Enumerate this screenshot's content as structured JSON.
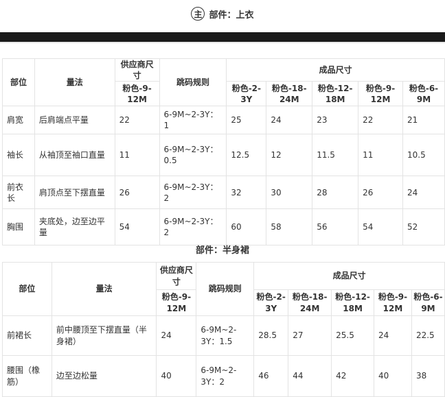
{
  "header": {
    "badge": "主",
    "title": "部件：上衣"
  },
  "tables": [
    {
      "headers": {
        "part": "部位",
        "method": "量法",
        "supplier_size": "供应商尺寸",
        "supplier_col": "粉色-9-12M",
        "rule": "跳码规则",
        "finished": "成品尺寸",
        "sizes": [
          "粉色-2-3Y",
          "粉色-18-24M",
          "粉色-12-18M",
          "粉色-9-12M",
          "粉色-6-9M"
        ]
      },
      "rows": [
        {
          "part": "肩宽",
          "method": "后肩端点平量",
          "supplier": "22",
          "rule": "6-9M~2-3Y：1",
          "values": [
            "25",
            "24",
            "23",
            "22",
            "21"
          ]
        },
        {
          "part": "袖长",
          "method": "从袖顶至袖口直量",
          "supplier": "11",
          "rule": "6-9M~2-3Y：0.5",
          "values": [
            "12.5",
            "12",
            "11.5",
            "11",
            "10.5"
          ]
        },
        {
          "part": "前衣长",
          "method": "肩顶点至下摆直量",
          "supplier": "26",
          "rule": "6-9M~2-3Y：2",
          "values": [
            "32",
            "30",
            "28",
            "26",
            "24"
          ]
        },
        {
          "part": "胸围",
          "method": "夹底处，边至边平量",
          "supplier": "54",
          "rule": "6-9M~2-3Y：2",
          "values": [
            "60",
            "58",
            "56",
            "54",
            "52"
          ]
        }
      ]
    },
    {
      "title": "部件：半身裙",
      "headers": {
        "part": "部位",
        "method": "量法",
        "supplier_size": "供应商尺寸",
        "supplier_col": "粉色-9-12M",
        "rule": "跳码规则",
        "finished": "成品尺寸",
        "sizes": [
          "粉色-2-3Y",
          "粉色-18-24M",
          "粉色-12-18M",
          "粉色-9-12M",
          "粉色-6-9M"
        ]
      },
      "rows": [
        {
          "part": "前裙长",
          "method": "前中腰顶至下摆直量（半身裙）",
          "supplier": "24",
          "rule": "6-9M~2-3Y：1.5",
          "values": [
            "28.5",
            "27",
            "25.5",
            "24",
            "22.5"
          ]
        },
        {
          "part": "腰围（橡筋）",
          "method": "边至边松量",
          "supplier": "40",
          "rule": "6-9M~2-3Y：2",
          "values": [
            "46",
            "44",
            "42",
            "40",
            "38"
          ]
        }
      ]
    }
  ]
}
